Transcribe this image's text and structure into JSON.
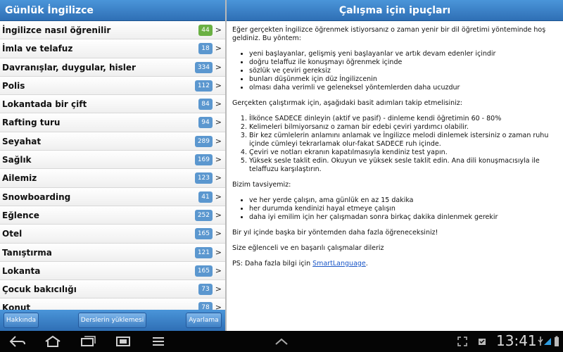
{
  "left": {
    "title": "Günlük İngilizce",
    "lessons": [
      {
        "title": "İngilizce nasıl öğrenilir",
        "count": "44",
        "accent": "#6ab043"
      },
      {
        "title": "İmla ve telafuz",
        "count": "18"
      },
      {
        "title": "Davranışlar, duygular, hisler",
        "count": "334"
      },
      {
        "title": "Polis",
        "count": "112"
      },
      {
        "title": "Lokantada bir çift",
        "count": "84"
      },
      {
        "title": "Rafting turu",
        "count": "94"
      },
      {
        "title": "Seyahat",
        "count": "289"
      },
      {
        "title": "Sağlık",
        "count": "169"
      },
      {
        "title": "Ailemiz",
        "count": "123"
      },
      {
        "title": "Snowboarding",
        "count": "41"
      },
      {
        "title": "Eğlence",
        "count": "252"
      },
      {
        "title": "Otel",
        "count": "165"
      },
      {
        "title": "Tanıştırma",
        "count": "121"
      },
      {
        "title": "Lokanta",
        "count": "165"
      },
      {
        "title": "Çocuk bakıcılığı",
        "count": "73"
      },
      {
        "title": "Konut",
        "count": "78"
      }
    ],
    "chevron": ">",
    "footer": {
      "about": "Hakkında",
      "download": "Derslerin yüklemesi",
      "settings": "Ayarlama"
    }
  },
  "right": {
    "title": "Çalışma için ipuçları",
    "intro": "Eğer gerçekten İngilizce öğrenmek istiyorsanız o zaman yenir bir dil öğretimi yönteminde hoş geldiniz. Bu yöntem:",
    "features": [
      "yeni başlayanlar, gelişmiş yeni başlayanlar ve artık devam edenler içindir",
      "doğru telaffuz ile konuşmayı öğrenmek içinde",
      "sözlük ve çeviri gereksiz",
      "bunları düşünmek için düz İngilizcenin",
      "olması daha verimli ve geleneksel yöntemlerden daha ucuzdur"
    ],
    "steps_intro": "Gerçekten çalıştırmak için, aşağıdaki basit adımları takip etmelisiniz:",
    "steps": [
      "İlkönce SADECE dinleyin (aktif ve pasif) - dinleme kendi öğretimin 60 - 80%",
      "Kelimeleri bilmiyorsanız o zaman bir edebi çeviri yardımcı olabilir.",
      "Bir kez cümlelerin anlamını anlamak ve İngilizce melodi dinlemek istersiniz o zaman ruhu içinde cümleyi tekrarlamak olur-fakat SADECE ruh içinde.",
      "Çeviri ve notları ekranın kapatılmasıyla kendiniz test yapın.",
      "Yüksek sesle taklit edin. Okuyun ve yüksek sesle taklit edin. Ana dili konuşmacısıyla ile telaffuzu karşılaştırın."
    ],
    "tips_intro": "Bizim tavsiyemiz:",
    "tips": [
      "ve her yerde çalışın, ama günlük en az 15 dakika",
      "her durumda kendinizi hayal etmeye çalışın",
      "daha iyi emilim için her çalışmadan sonra birkaç dakika dinlenmek gerekir"
    ],
    "closing": "Bir yıl içinde başka bir yöntemden daha fazla öğreneceksiniz!",
    "wishes": "Size eğlenceli ve en başarılı çalışmalar dileriz",
    "ps_prefix": "PS: Daha fazla bilgi için ",
    "ps_link": "SmartLanguage",
    "ps_suffix": "."
  },
  "statusbar": {
    "time": "13:41",
    "icons": [
      "back-icon",
      "home-icon",
      "recent-apps-icon",
      "screenshot-icon",
      "menu-icon",
      "up-arrow-icon",
      "fullscreen-icon",
      "notification-icon",
      "usb-icon",
      "wifi-icon",
      "battery-icon"
    ]
  }
}
